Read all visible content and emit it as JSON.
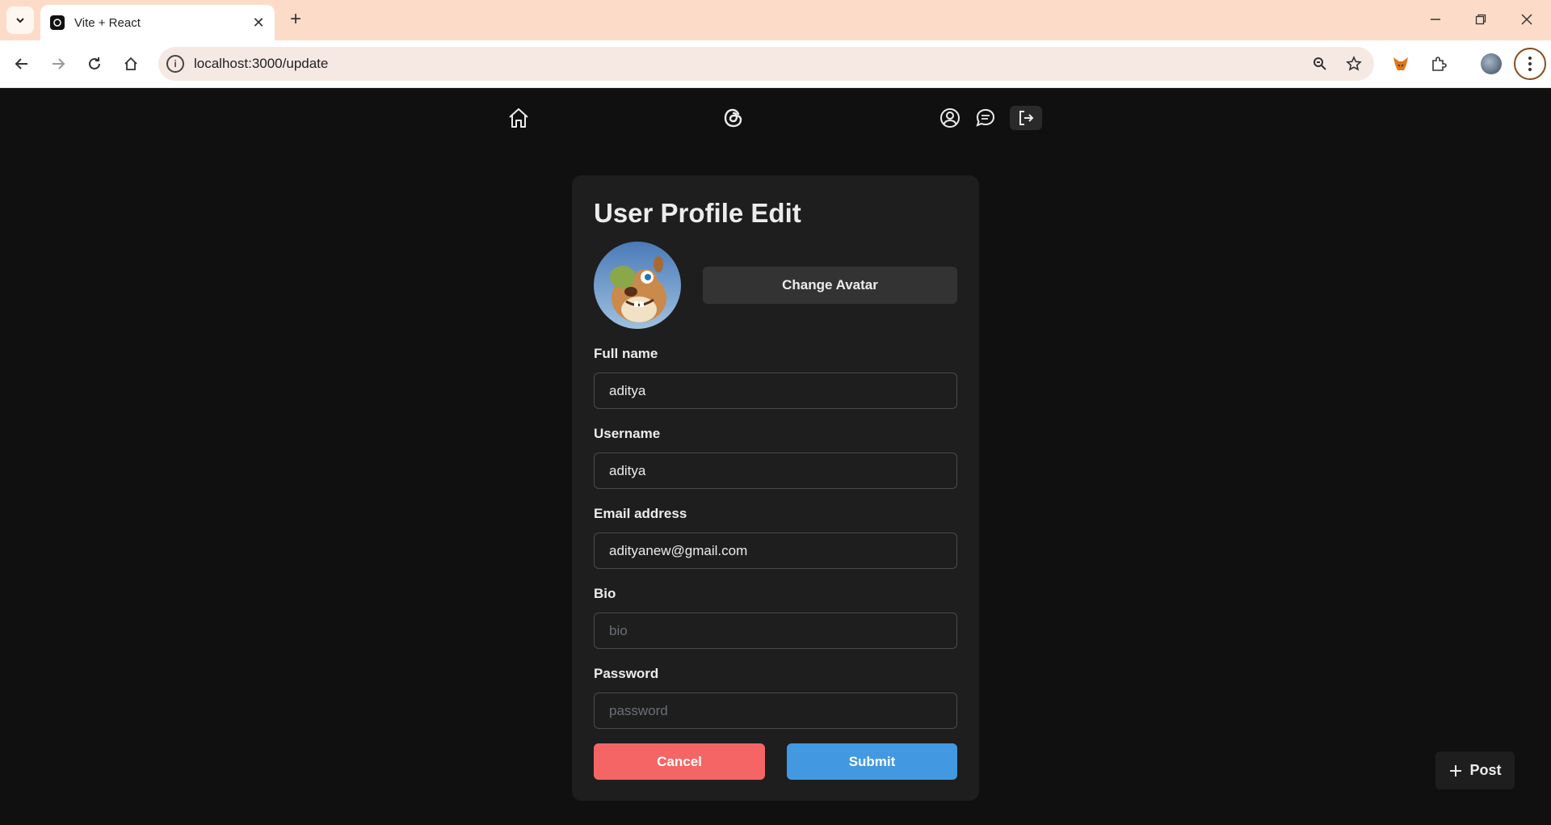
{
  "browser": {
    "tab_title": "Vite + React",
    "url": "localhost:3000/update"
  },
  "form": {
    "title": "User Profile Edit",
    "change_avatar_label": "Change Avatar",
    "fields": {
      "full_name": {
        "label": "Full name",
        "value": "aditya"
      },
      "username": {
        "label": "Username",
        "value": "aditya"
      },
      "email": {
        "label": "Email address",
        "value": "adityanew@gmail.com"
      },
      "bio": {
        "label": "Bio",
        "placeholder": "bio"
      },
      "password": {
        "label": "Password",
        "placeholder": "password"
      }
    },
    "cancel_label": "Cancel",
    "submit_label": "Submit"
  },
  "post_button": {
    "label": "Post"
  },
  "colors": {
    "background": "#101010",
    "card": "#1e1e1e",
    "cancel": "#f56565",
    "submit": "#4299e1",
    "tabbar": "#fcdcc8"
  },
  "icons": [
    "home-icon",
    "threads-logo-icon",
    "user-icon",
    "chat-icon",
    "logout-icon",
    "plus-icon"
  ]
}
